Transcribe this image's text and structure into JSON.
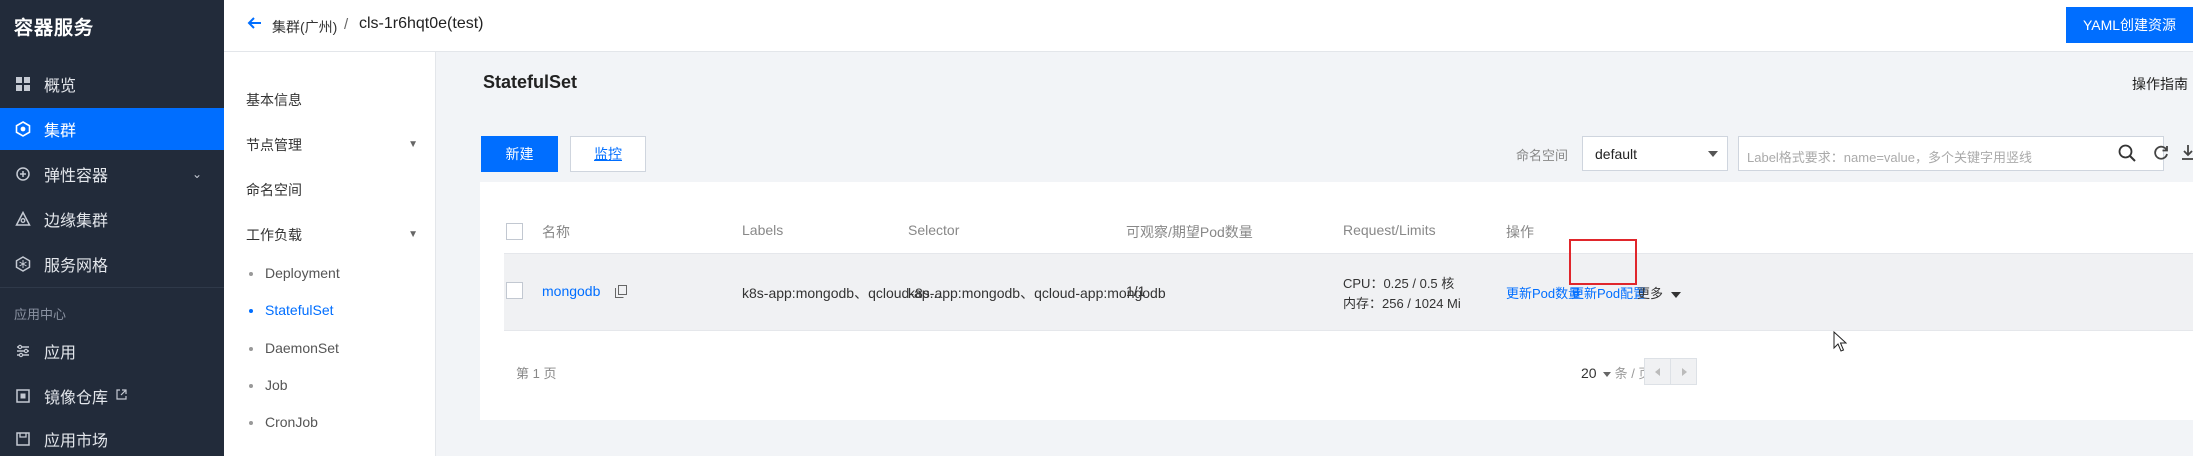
{
  "sidebar": {
    "title": "容器服务",
    "items": [
      {
        "label": "概览",
        "icon": "grid-icon"
      },
      {
        "label": "集群",
        "icon": "cluster-icon"
      },
      {
        "label": "弹性容器",
        "icon": "elastic-container-icon"
      },
      {
        "label": "边缘集群",
        "icon": "edge-cluster-icon"
      },
      {
        "label": "服务网格",
        "icon": "mesh-icon"
      }
    ],
    "section_label": "应用中心",
    "app_items": [
      {
        "label": "应用",
        "icon": "app-icon"
      },
      {
        "label": "镜像仓库",
        "icon": "image-repo-icon"
      },
      {
        "label": "应用市场",
        "icon": "market-icon"
      }
    ]
  },
  "topbar": {
    "breadcrumb_cluster": "集群(广州)",
    "breadcrumb_sep": "/",
    "breadcrumb_current": "cls-1r6hqt0e(test)",
    "yaml_button": "YAML创建资源"
  },
  "subnav": {
    "items": [
      "基本信息",
      "节点管理",
      "命名空间",
      "工作负载"
    ],
    "workloads": [
      "Deployment",
      "StatefulSet",
      "DaemonSet",
      "Job",
      "CronJob"
    ],
    "active": "StatefulSet"
  },
  "main": {
    "title": "StatefulSet",
    "guide": "操作指南",
    "new_button": "新建",
    "monitor_button": "监控",
    "namespace_label": "命名空间",
    "namespace_value": "default",
    "search_placeholder": "Label格式要求：name=value，多个关键字用竖线"
  },
  "table": {
    "headers": [
      "名称",
      "Labels",
      "Selector",
      "可观察/期望Pod数量",
      "Request/Limits",
      "操作"
    ],
    "rows": [
      {
        "name": "mongodb",
        "labels": "k8s-app:mongodb、qcloud-ap...",
        "selector": "k8s-app:mongodb、qcloud-app:mongodb",
        "pods": "1/1",
        "cpu": "CPU：0.25 / 0.5 核",
        "mem": "内存：256 / 1024 Mi",
        "action_update_count": "更新Pod数量",
        "action_update_config": "更新Pod配置",
        "action_more": "更多"
      }
    ],
    "pager_text": "第 1 页",
    "page_size": "20",
    "per_page_text": "条 / 页"
  },
  "colors": {
    "primary": "#006eff",
    "sidebar_bg": "#222b3a",
    "highlight": "#e0262b"
  }
}
